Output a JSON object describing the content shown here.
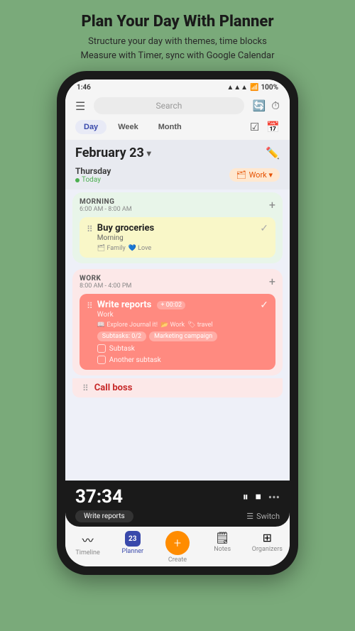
{
  "page": {
    "title": "Plan Your Day With Planner",
    "subtitle_line1": "Structure your day with themes, time blocks",
    "subtitle_line2": "Measure with Timer, sync with Google Calendar"
  },
  "status_bar": {
    "time": "1:46",
    "battery": "100%"
  },
  "search": {
    "placeholder": "Search"
  },
  "view_tabs": {
    "day": "Day",
    "week": "Week",
    "month": "Month"
  },
  "date_header": {
    "date": "February 23",
    "day_name": "Thursday",
    "today_label": "Today"
  },
  "work_badge": {
    "label": "Work ▾"
  },
  "morning_section": {
    "title": "MORNING",
    "time": "6:00 AM - 8:00 AM",
    "task": {
      "title": "Buy groceries",
      "subtitle": "Morning",
      "tags": "🗂 Family, 💙 Love"
    }
  },
  "work_section": {
    "title": "WORK",
    "time": "8:00 AM - 4:00 PM",
    "task": {
      "title": "Write reports",
      "subtitle": "Work",
      "time_badge": "+ 00:02",
      "tags": "📖 Explore Journal it!,  📂 Work,  🏷 travel",
      "subtasks": "Subtasks: 0/2",
      "campaign": "Marketing campaign",
      "checkbox1": "Subtask",
      "checkbox2": "Another subtask"
    }
  },
  "call_boss": {
    "title": "Call boss"
  },
  "timer": {
    "time": "37:34",
    "task_label": "Write reports",
    "switch_label": "Switch"
  },
  "bottom_nav": {
    "timeline": "Timeline",
    "planner": "Planner",
    "planner_badge": "23",
    "create": "Create",
    "notes": "Notes",
    "organizers": "Organizers"
  }
}
